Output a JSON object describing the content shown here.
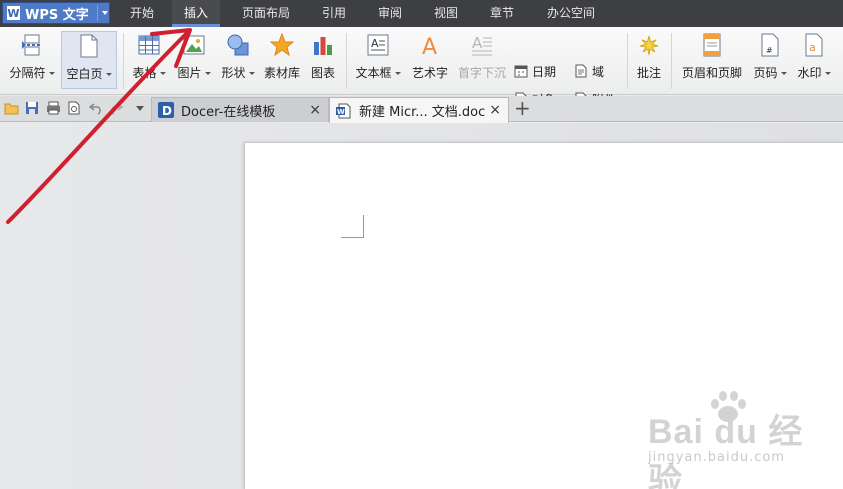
{
  "menubar": {
    "app_logo": "W",
    "app_label": "WPS 文字",
    "tabs": [
      {
        "label": "开始"
      },
      {
        "label": "插入"
      },
      {
        "label": "页面布局"
      },
      {
        "label": "引用"
      },
      {
        "label": "审阅"
      },
      {
        "label": "视图"
      },
      {
        "label": "章节"
      },
      {
        "label": "办公空间"
      }
    ],
    "active_tab": "插入",
    "colors": {
      "bar": "#3e3f42",
      "app_button": "#4f7ac6",
      "accent": "#6a8fd0"
    }
  },
  "ribbon": {
    "large_buttons": [
      {
        "label": "分隔符",
        "icon": "page-break-icon",
        "has_dropdown": true
      },
      {
        "label": "空白页",
        "icon": "blank-page-icon",
        "has_dropdown": true,
        "selected": true
      },
      {
        "label": "表格",
        "icon": "table-icon",
        "has_dropdown": true
      },
      {
        "label": "图片",
        "icon": "picture-icon",
        "has_dropdown": true
      },
      {
        "label": "形状",
        "icon": "shapes-icon",
        "has_dropdown": true
      },
      {
        "label": "素材库",
        "icon": "star-icon",
        "has_dropdown": false
      },
      {
        "label": "图表",
        "icon": "chart-icon",
        "has_dropdown": false
      },
      {
        "label": "文本框",
        "icon": "text-box-icon",
        "has_dropdown": true
      },
      {
        "label": "艺术字",
        "icon": "word-art-icon",
        "has_dropdown": false
      },
      {
        "label": "首字下沉",
        "icon": "drop-cap-icon",
        "has_dropdown": false,
        "disabled": true
      },
      {
        "label": "批注",
        "icon": "comment-icon",
        "has_dropdown": false
      },
      {
        "label": "页眉和页脚",
        "icon": "header-footer-icon",
        "has_dropdown": false
      },
      {
        "label": "页码",
        "icon": "page-number-icon",
        "has_dropdown": true
      },
      {
        "label": "水印",
        "icon": "watermark-icon",
        "has_dropdown": true
      }
    ],
    "small_buttons": [
      {
        "label": "日期",
        "icon": "calendar-icon"
      },
      {
        "label": "对象",
        "icon": "object-icon",
        "has_dropdown": true
      },
      {
        "label": "域",
        "icon": "field-icon"
      },
      {
        "label": "附件",
        "icon": "attachment-icon"
      }
    ]
  },
  "tabstrip": {
    "quick_access": [
      "open-folder-icon",
      "save-icon",
      "print-icon",
      "print-preview-icon",
      "undo-icon",
      "redo-icon",
      "customize-dropdown-icon"
    ],
    "tabs": [
      {
        "label": "Docer-在线模板",
        "icon": "docer-icon",
        "active": false
      },
      {
        "label": "新建 Micr... 文档.doc",
        "icon": "word-doc-icon",
        "active": true
      }
    ],
    "close_glyph": "×",
    "add_glyph": "+"
  },
  "watermark": {
    "main": "Bai du 经验",
    "sub": "jingyan.baidu.com"
  }
}
